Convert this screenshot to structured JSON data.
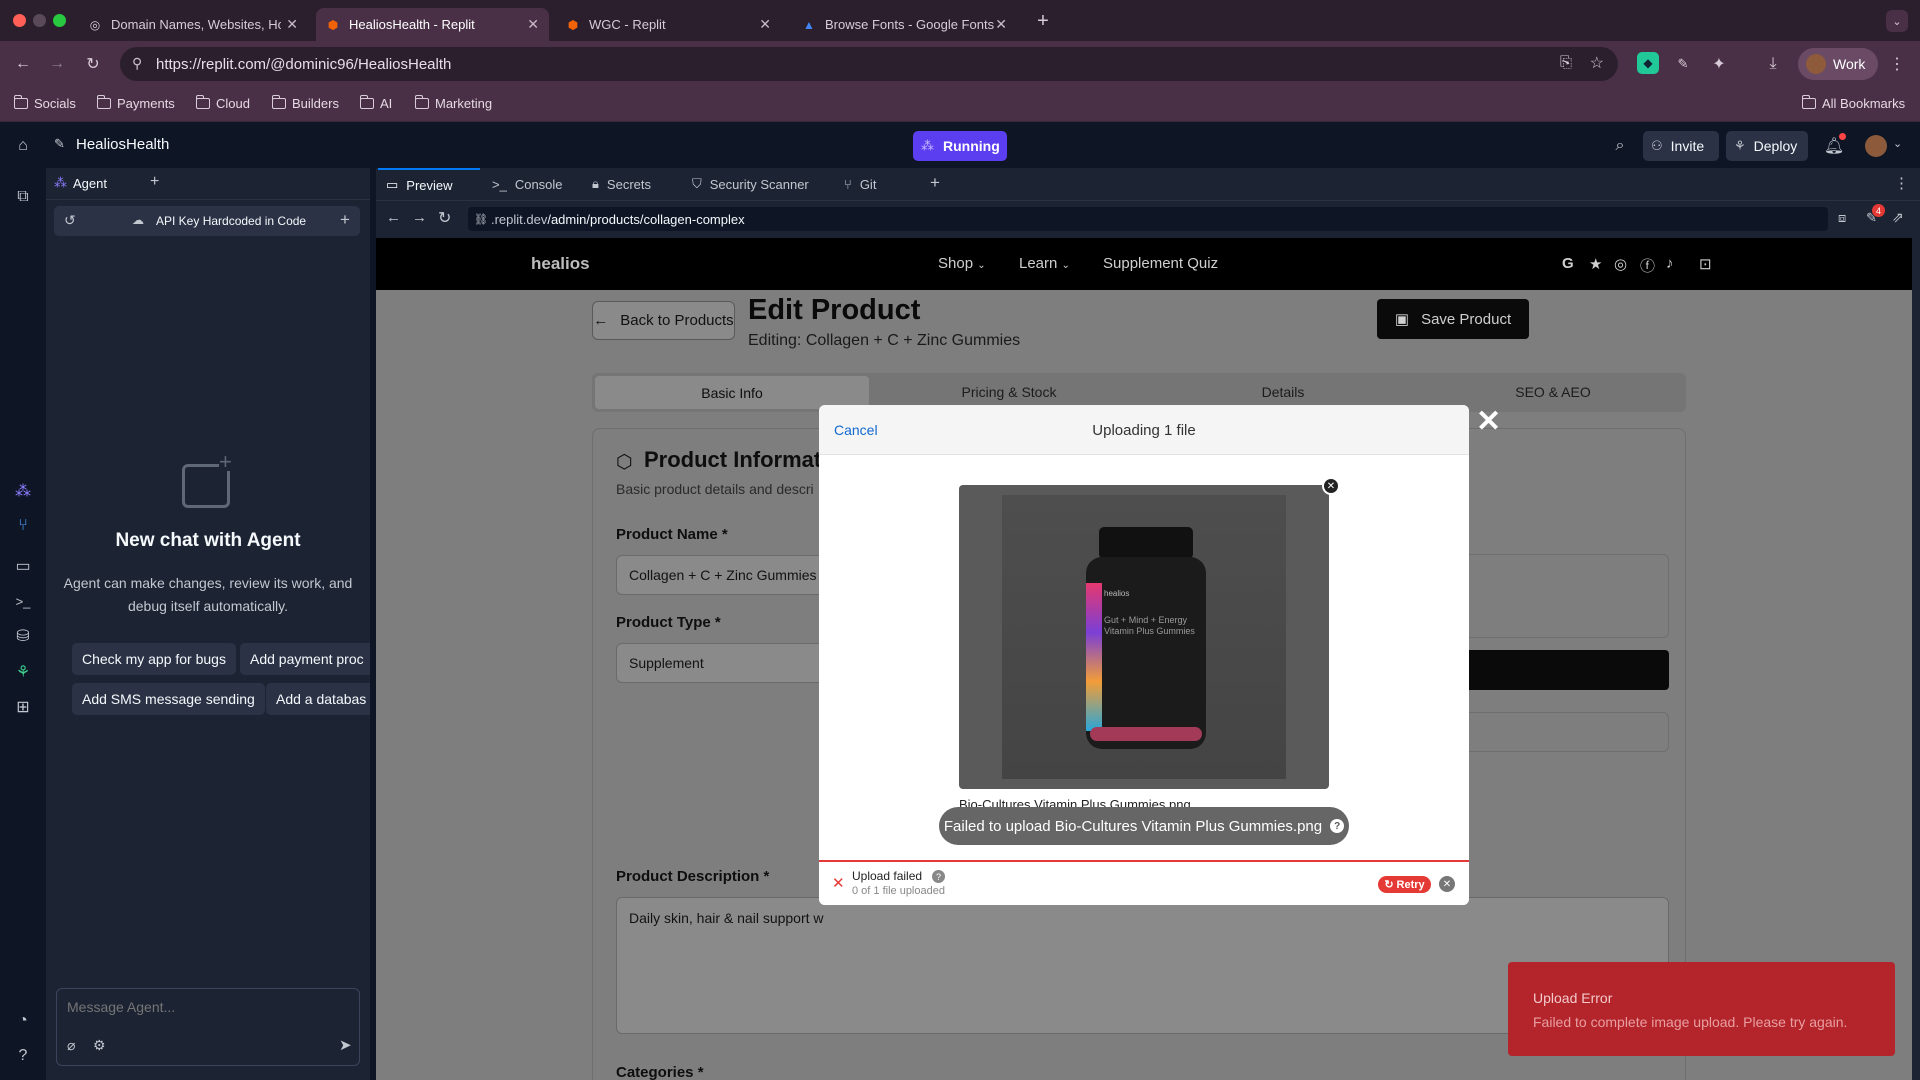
{
  "browser": {
    "tabs": [
      {
        "title": "Domain Names, Websites, Ho",
        "active": false
      },
      {
        "title": "HealiosHealth - Replit",
        "active": true
      },
      {
        "title": "WGC - Replit",
        "active": false
      },
      {
        "title": "Browse Fonts - Google Fonts",
        "active": false
      }
    ],
    "url": "https://replit.com/@dominic96/HealiosHealth",
    "profile_label": "Work",
    "bookmarks": [
      "Socials",
      "Payments",
      "Cloud",
      "Builders",
      "AI",
      "Marketing"
    ],
    "all_bookmarks": "All Bookmarks"
  },
  "replit": {
    "project_name": "HealiosHealth",
    "status": "Running",
    "invite_label": "Invite",
    "deploy_label": "Deploy",
    "agent_tab": "Agent",
    "chat_title": "API Key Hardcoded in Code",
    "new_chat_heading": "New chat with Agent",
    "new_chat_desc": "Agent can make changes, review its work, and debug itself automatically.",
    "suggestions": [
      "Check my app for bugs",
      "Add payment proc",
      "Add SMS message sending",
      "Add a databas"
    ],
    "message_placeholder": "Message Agent...",
    "workspace_tabs": [
      "Preview",
      "Console",
      "Secrets",
      "Security Scanner",
      "Git"
    ],
    "preview_url_prefix": ".replit.dev",
    "preview_url_path": "/admin/products/collagen-complex",
    "notif_badge": "4"
  },
  "site": {
    "logo": "healios",
    "nav": [
      "Shop",
      "Learn",
      "Supplement Quiz"
    ],
    "back_label": "Back to Products",
    "page_title": "Edit Product",
    "subtitle": "Editing: Collagen + C + Zinc Gummies",
    "save_label": "Save Product",
    "tabs": [
      "Basic Info",
      "Pricing & Stock",
      "Details",
      "SEO & AEO"
    ],
    "section_title": "Product Informat",
    "section_desc": "Basic product details and descri",
    "product_name_label": "Product Name *",
    "product_name_value": "Collagen + C + Zinc Gummies",
    "product_type_label": "Product Type *",
    "product_type_value": "Supplement",
    "description_label": "Product Description *",
    "description_value": "Daily skin, hair & nail support w",
    "categories_label": "Categories *"
  },
  "modal": {
    "cancel": "Cancel",
    "title": "Uploading 1 file",
    "filename_partial": "Bio-Cultures Vitamin Plus Gummies.png",
    "tooltip": "Failed to upload Bio-Cultures Vitamin Plus Gummies.png",
    "status": "Upload failed",
    "progress_text": "0 of 1 file uploaded",
    "retry": "Retry",
    "jar_brand": "healios",
    "jar_text": "Gut + Mind + Energy Vitamin Plus Gummies"
  },
  "toast": {
    "title": "Upload Error",
    "message": "Failed to complete image upload. Please try again."
  },
  "colors": {
    "replit_bg": "#0e1525",
    "running": "#5b3ef0",
    "error_red": "#b3252b",
    "retry_red": "#e53935"
  }
}
